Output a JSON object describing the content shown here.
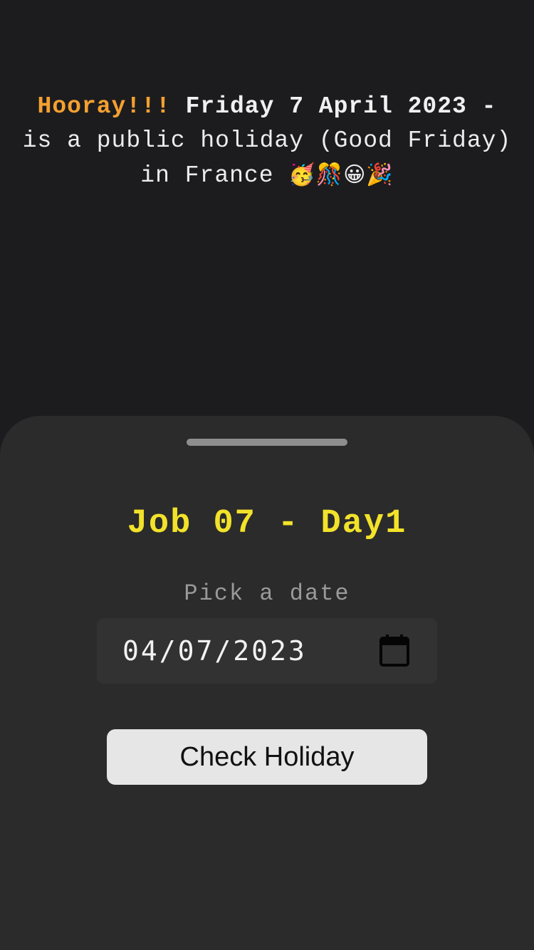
{
  "message": {
    "prefix": "Hooray!!!",
    "date": "Friday 7 April 2023 -",
    "body": "is a public holiday (Good Friday) in France",
    "emojis": [
      "🥳",
      "🎊",
      "😀",
      "🎉"
    ]
  },
  "sheet": {
    "title": "Job 07 - Day1",
    "date_label": "Pick a date",
    "date_value": "04/07/2023",
    "date_icon": "calendar-icon",
    "button_label": "Check Holiday"
  },
  "colors": {
    "background": "#1c1c1e",
    "sheet": "#2b2b2b",
    "hooray": "#f5a030",
    "title": "#f2e22a",
    "button": "#e6e6e6"
  }
}
